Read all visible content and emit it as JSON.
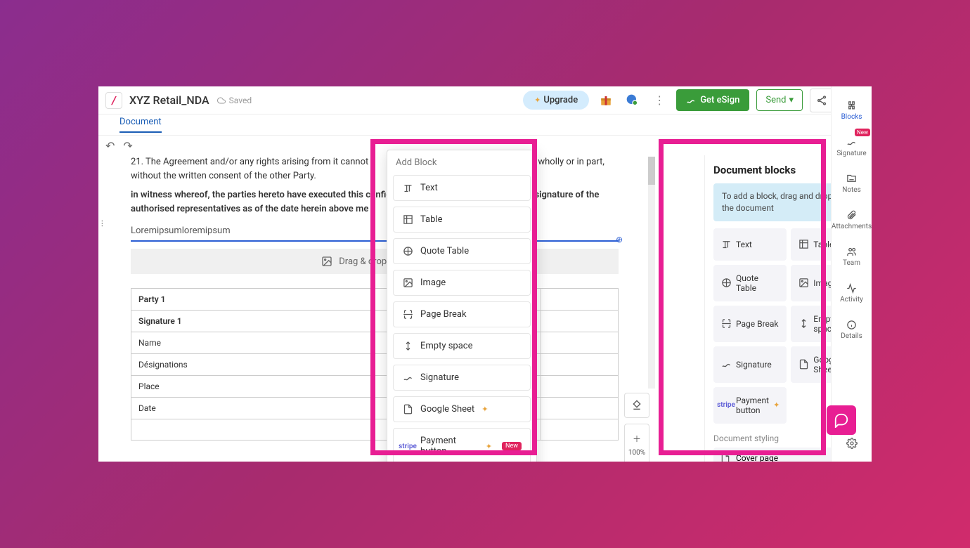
{
  "topbar": {
    "logo": "/",
    "title": "XYZ Retail_NDA",
    "saved_label": "Saved",
    "upgrade_label": "Upgrade",
    "esign_label": "Get eSign",
    "send_label": "Send"
  },
  "tabs": {
    "document": "Document"
  },
  "doc": {
    "para1_prefix": "21. The Agreement and/or any rights arising from it cannot",
    "para1_suffix": "wholly or in part, without the written consent of the other Party.",
    "para2": "in witness whereof, the parties hereto have executed this confid",
    "para2b": "signature of the authorised representatives as of the date herein above me",
    "input_val": "Loremipsumloremipsum",
    "dropzone": "Drag & drop image file",
    "table": {
      "party": "Party 1",
      "signature": "Signature 1",
      "rows": [
        "Name",
        "Désignations",
        "Place",
        "Date"
      ]
    }
  },
  "add_block": {
    "title": "Add Block",
    "items": [
      {
        "label": "Text",
        "icon": "text"
      },
      {
        "label": "Table",
        "icon": "table"
      },
      {
        "label": "Quote Table",
        "icon": "quote-table"
      },
      {
        "label": "Image",
        "icon": "image"
      },
      {
        "label": "Page Break",
        "icon": "page-break"
      },
      {
        "label": "Empty space",
        "icon": "empty-space"
      },
      {
        "label": "Signature",
        "icon": "signature"
      },
      {
        "label": "Google Sheet",
        "icon": "google-sheet",
        "sparkle": true
      },
      {
        "label": "Payment button",
        "icon": "stripe",
        "sparkle": true,
        "new": true
      }
    ]
  },
  "sidebar_blocks": {
    "title": "Document blocks",
    "hint": "To add a block, drag and drop it on the document",
    "items": [
      {
        "label": "Text",
        "icon": "text"
      },
      {
        "label": "Table",
        "icon": "table"
      },
      {
        "label": "Quote Table",
        "icon": "quote-table"
      },
      {
        "label": "Image",
        "icon": "image"
      },
      {
        "label": "Page Break",
        "icon": "page-break"
      },
      {
        "label": "Empty space",
        "icon": "empty-space"
      },
      {
        "label": "Signature",
        "icon": "signature"
      },
      {
        "label": "Google Sheet",
        "icon": "google-sheet",
        "sparkle": true
      },
      {
        "label": "Payment button",
        "icon": "stripe",
        "sparkle": true
      }
    ],
    "styling_label": "Document styling",
    "cover_label": "Cover page"
  },
  "rail": [
    {
      "label": "Blocks",
      "icon": "puzzle",
      "active": true
    },
    {
      "label": "Signature",
      "icon": "signature",
      "new": true
    },
    {
      "label": "Notes",
      "icon": "notes"
    },
    {
      "label": "Attachments",
      "icon": "paperclip"
    },
    {
      "label": "Team",
      "icon": "team"
    },
    {
      "label": "Activity",
      "icon": "activity"
    },
    {
      "label": "Details",
      "icon": "details"
    }
  ],
  "zoom": {
    "value": "100%"
  }
}
